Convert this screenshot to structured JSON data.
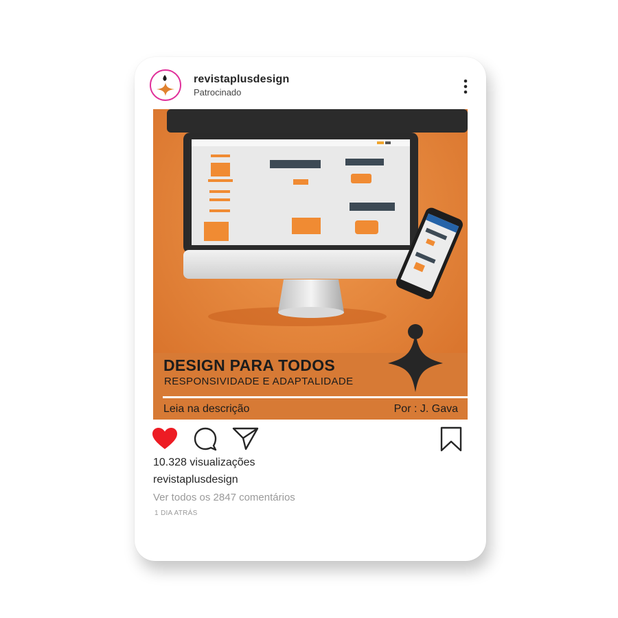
{
  "header": {
    "username": "revistaplusdesign",
    "sponsored_label": "Patrocinado",
    "avatar_icon": "sparkle-logo-icon",
    "more_icon": "more-vertical-icon"
  },
  "post": {
    "title": "DESIGN PARA TODOS",
    "subtitle": "RESPONSIVIDADE E ADAPTALIDADE",
    "read_more": "Leia na descrição",
    "author": "Por : J. Gava",
    "image_description_icons": [
      "desktop-monitor",
      "smartphone",
      "sparkle-logo-icon"
    ]
  },
  "actions": {
    "like_icon": "heart-icon",
    "comment_icon": "comment-icon",
    "share_icon": "send-icon",
    "save_icon": "bookmark-icon",
    "liked": true
  },
  "stats": {
    "views": "10.328 visualizações",
    "caption_user": "revistaplusdesign",
    "view_comments": "Ver todos os 2847 comentários",
    "time": "1 DIA ATRÁS"
  },
  "colors": {
    "accent_orange": "#e8843a",
    "like_red": "#ed1c24",
    "avatar_ring": "#e0309a"
  }
}
